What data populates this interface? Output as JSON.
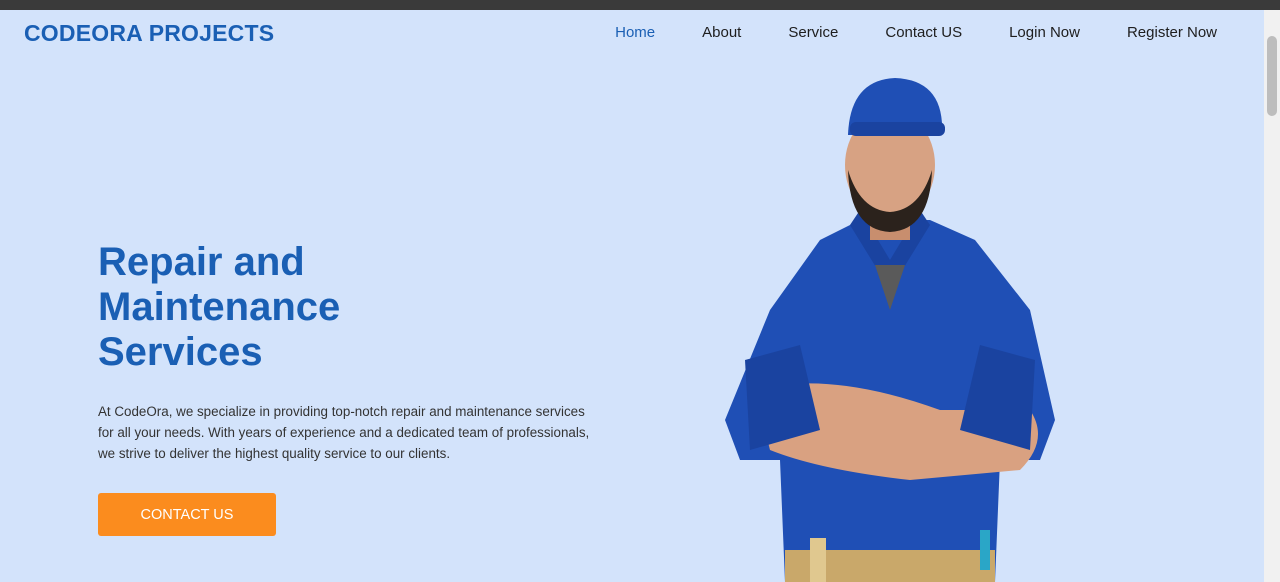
{
  "nav": {
    "brand": "CODEORA PROJECTS",
    "items": [
      {
        "label": "Home",
        "active": true
      },
      {
        "label": "About"
      },
      {
        "label": "Service"
      },
      {
        "label": "Contact US"
      },
      {
        "label": "Login Now"
      },
      {
        "label": "Register Now"
      }
    ]
  },
  "hero": {
    "title_lines": [
      "Repair and",
      "Maintenance",
      "Services"
    ],
    "description_lines": [
      "At CodeOra, we specialize in providing top-notch repair and maintenance services",
      "for all your needs. With years of experience and a dedicated team of professionals,",
      "we strive to deliver the highest quality service to our clients."
    ],
    "cta_label": "CONTACT US"
  },
  "colors": {
    "background": "#d3e3fb",
    "brand_blue": "#1a5fb4",
    "cta_orange": "#fb8c1e"
  },
  "image": {
    "subject": "smiling worker in blue overalls and cap, arms crossed"
  }
}
